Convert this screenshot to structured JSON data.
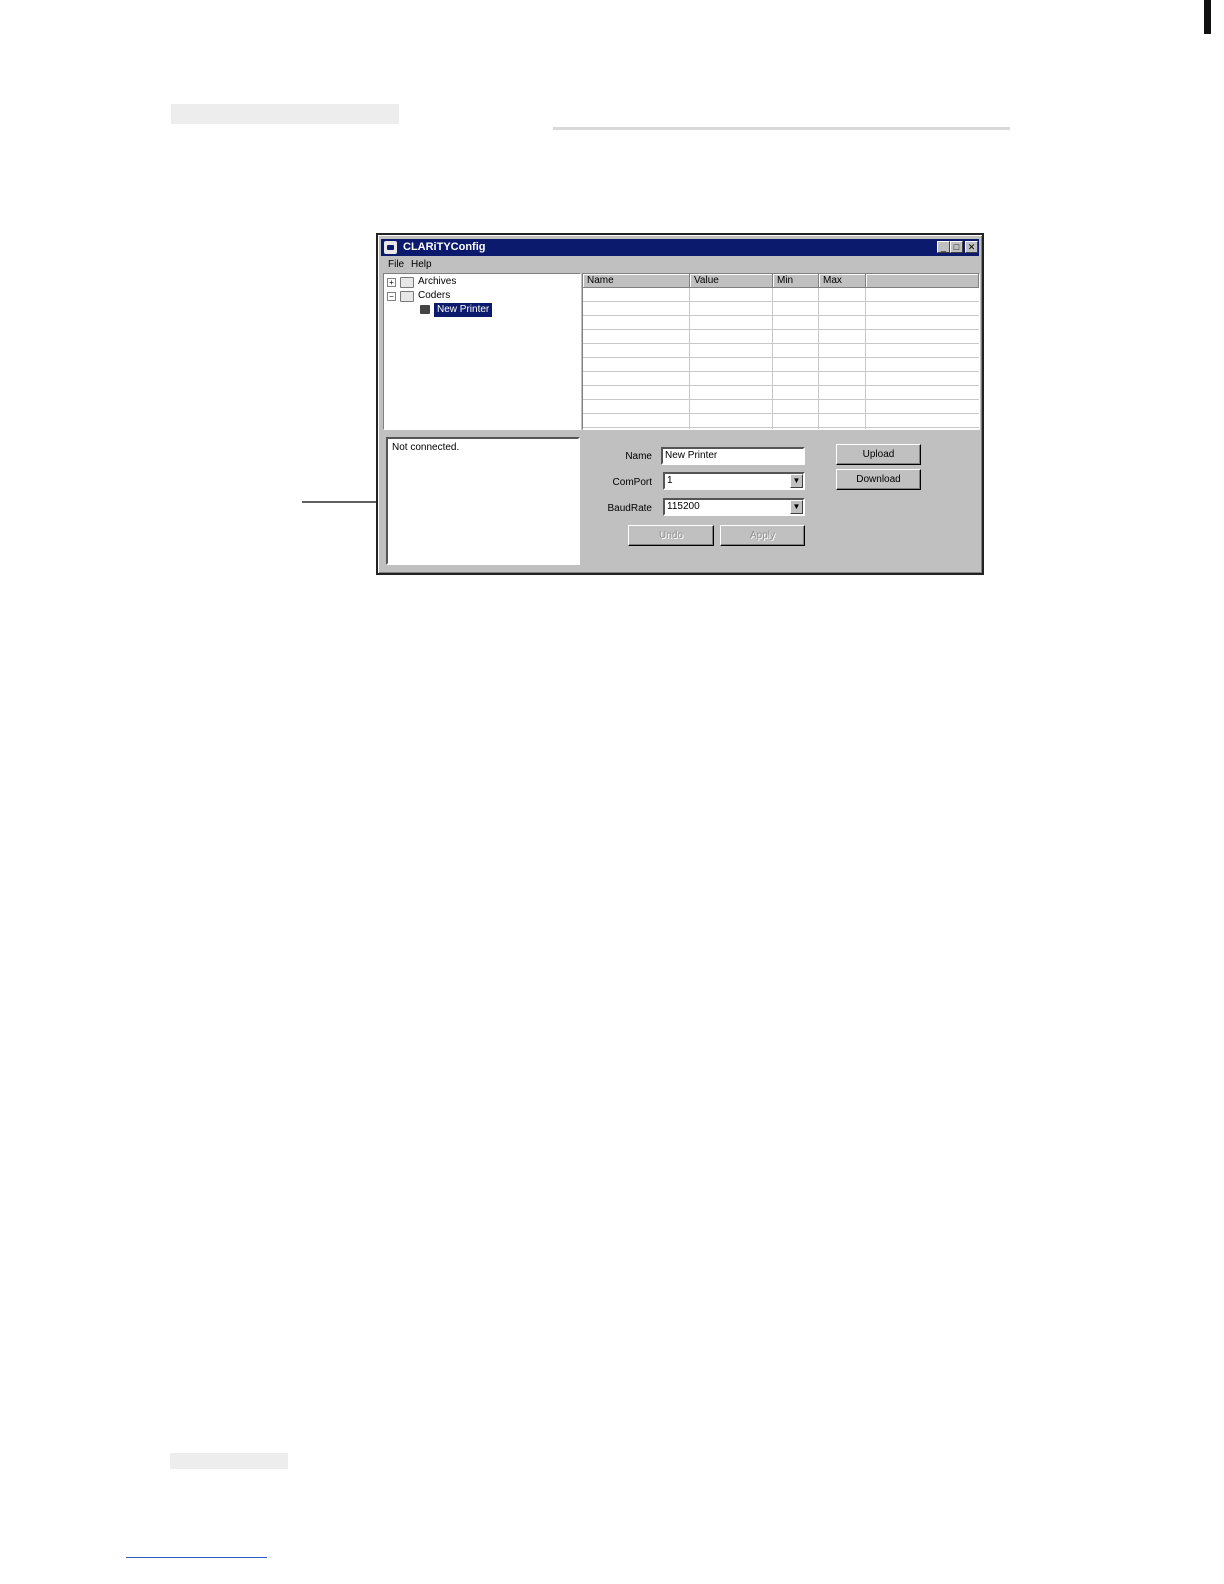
{
  "window": {
    "title": "CLARiTYConfig",
    "minimize_glyph": "_",
    "maximize_glyph": "□",
    "close_glyph": "✕"
  },
  "menu": [
    "File",
    "Help"
  ],
  "tree": {
    "expanders": {
      "collapsed": "+",
      "expanded": "−"
    },
    "items": [
      {
        "label": "Archives",
        "icon": "folder-icon",
        "state": "collapsed"
      },
      {
        "label": "Coders",
        "icon": "folder-icon",
        "state": "expanded"
      },
      {
        "label": "New Printer",
        "icon": "printer-icon",
        "selected": true
      }
    ]
  },
  "grid": {
    "columns": [
      "Name",
      "Value",
      "Min",
      "Max",
      ""
    ],
    "rows": []
  },
  "status": {
    "text": "Not connected."
  },
  "form": {
    "name_label": "Name",
    "name_value": "New Printer",
    "comport_label": "ComPort",
    "comport_value": "1",
    "baudrate_label": "BaudRate",
    "baudrate_value": "115200",
    "dropdown_glyph": "▼"
  },
  "buttons": {
    "upload": "Upload",
    "download": "Download",
    "undo": "Undo",
    "apply": "Apply"
  }
}
